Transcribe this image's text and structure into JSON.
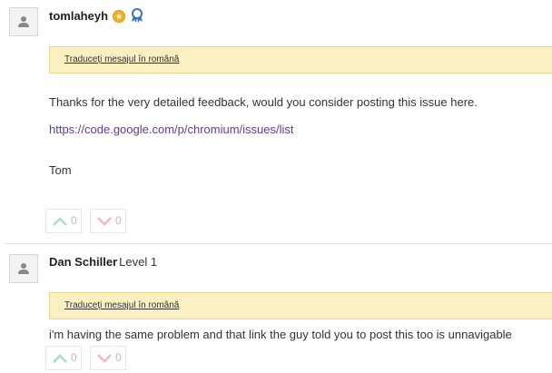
{
  "posts": [
    {
      "author": "tomlaheyh",
      "level": "",
      "translate_label": "Traduceți mesajul în română",
      "paragraphs": [
        "Thanks for the very detailed feedback, would you consider posting this issue here."
      ],
      "link": "https://code.google.com/p/chromium/issues/list",
      "signature": "Tom",
      "upvotes": "0",
      "downvotes": "0"
    },
    {
      "author": "Dan Schiller",
      "level": "Level 1",
      "translate_label": "Traduceți mesajul în română",
      "paragraphs": [
        "i'm having the same problem and that link the guy told you to post this too is unnavigable"
      ],
      "upvotes": "0",
      "downvotes": "0"
    }
  ],
  "colors": {
    "translate_bg": "#faf0c2",
    "link": "#5f3e8c",
    "upvote_icon": "#a9dcc9",
    "downvote_icon": "#f2b8b8",
    "badge_gold": "#f0b22b",
    "badge_blue": "#3a73c6"
  },
  "icons": {
    "avatar": "person-silhouette-icon",
    "upvote": "chevron-up-icon",
    "downvote": "chevron-down-icon",
    "top_contributor": "star-badge-icon",
    "rising_star": "ribbon-badge-icon"
  }
}
